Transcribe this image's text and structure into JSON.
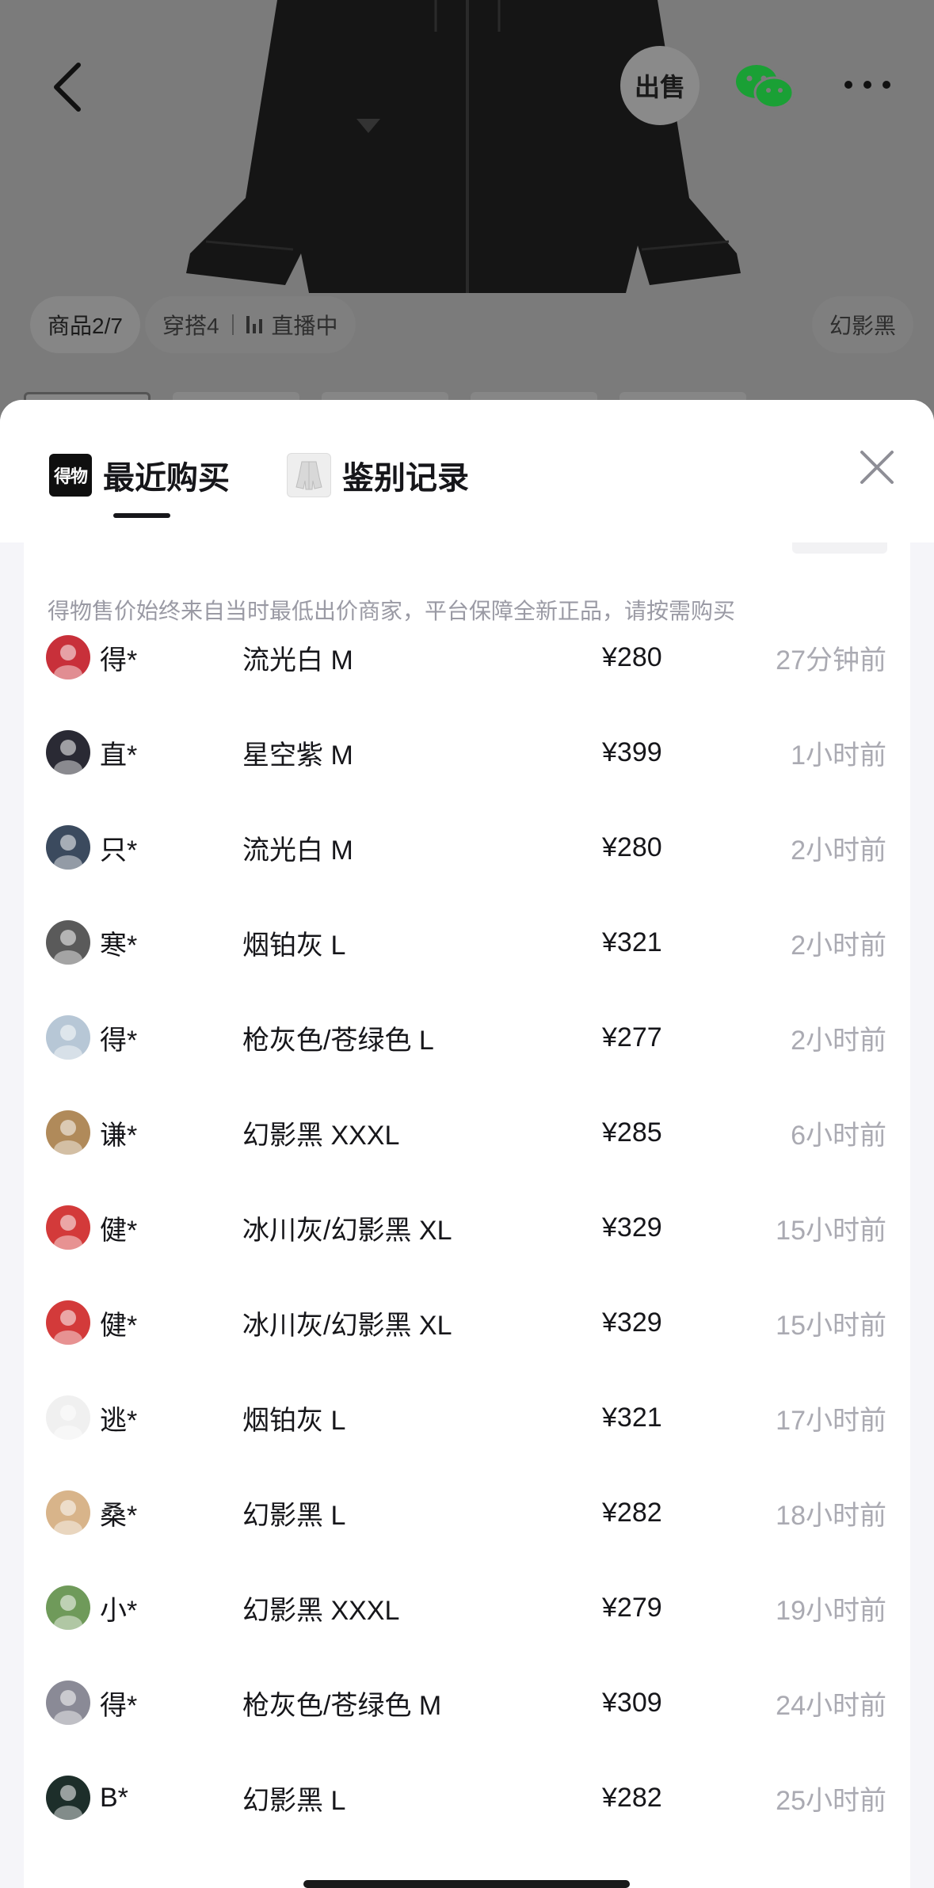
{
  "product_page": {
    "sell_label": "出售",
    "chips": {
      "product": "商品2/7",
      "outfit": "穿搭4",
      "live": "直播中",
      "color": "幻影黑"
    }
  },
  "sheet": {
    "tabs": [
      {
        "icon": "得物",
        "label": "最近购买"
      },
      {
        "label": "鉴别记录"
      }
    ],
    "notice": "得物售价始终来自当时最低出价商家，平台保障全新正品，请按需购买",
    "records": [
      {
        "buyer": "得*",
        "item": "流光白 M",
        "price": "¥280",
        "time": "27分钟前",
        "avatar_color": "#c8303a"
      },
      {
        "buyer": "直*",
        "item": "星空紫 M",
        "price": "¥399",
        "time": "1小时前",
        "avatar_color": "#2a2a34"
      },
      {
        "buyer": "只*",
        "item": "流光白 M",
        "price": "¥280",
        "time": "2小时前",
        "avatar_color": "#3b4a5e"
      },
      {
        "buyer": "寒*",
        "item": "烟铂灰 L",
        "price": "¥321",
        "time": "2小时前",
        "avatar_color": "#5a5a5a"
      },
      {
        "buyer": "得*",
        "item": "枪灰色/苍绿色 L",
        "price": "¥277",
        "time": "2小时前",
        "avatar_color": "#b7c7d6"
      },
      {
        "buyer": "谦*",
        "item": "幻影黑 XXXL",
        "price": "¥285",
        "time": "6小时前",
        "avatar_color": "#b08a5a"
      },
      {
        "buyer": "健*",
        "item": "冰川灰/幻影黑 XL",
        "price": "¥329",
        "time": "15小时前",
        "avatar_color": "#d33a3a"
      },
      {
        "buyer": "健*",
        "item": "冰川灰/幻影黑 XL",
        "price": "¥329",
        "time": "15小时前",
        "avatar_color": "#d33a3a"
      },
      {
        "buyer": "逃*",
        "item": "烟铂灰 L",
        "price": "¥321",
        "time": "17小时前",
        "avatar_color": "#f0f0f0"
      },
      {
        "buyer": "桑*",
        "item": "幻影黑 L",
        "price": "¥282",
        "time": "18小时前",
        "avatar_color": "#d8b48a"
      },
      {
        "buyer": "小*",
        "item": "幻影黑 XXXL",
        "price": "¥279",
        "time": "19小时前",
        "avatar_color": "#6f9a5a"
      },
      {
        "buyer": "得*",
        "item": "枪灰色/苍绿色 M",
        "price": "¥309",
        "time": "24小时前",
        "avatar_color": "#8a8a96"
      },
      {
        "buyer": "B*",
        "item": "幻影黑 L",
        "price": "¥282",
        "time": "25小时前",
        "avatar_color": "#1d2e2a"
      }
    ]
  }
}
